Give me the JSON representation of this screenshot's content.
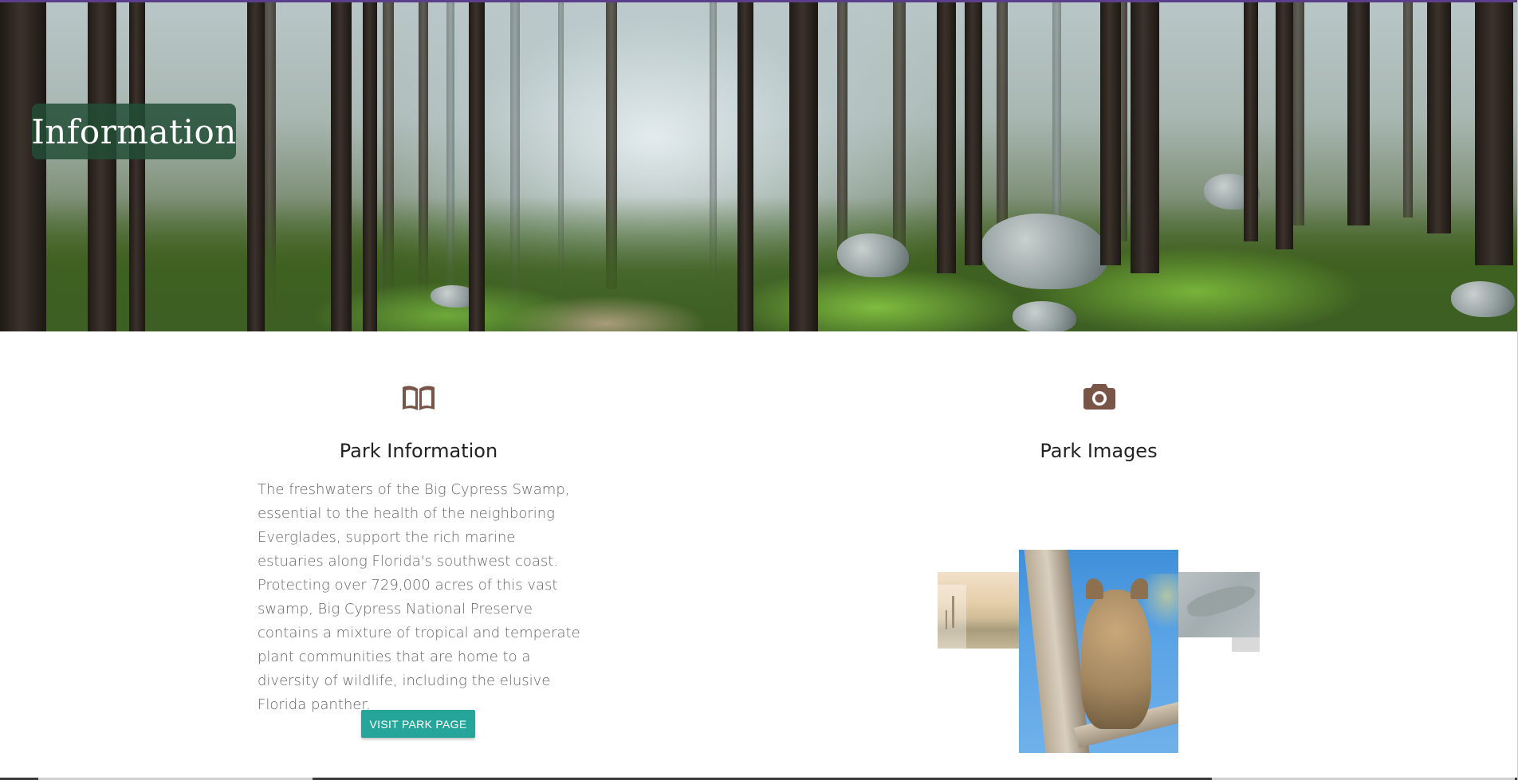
{
  "hero": {
    "title": "Information"
  },
  "columns": {
    "info": {
      "icon": "book-icon",
      "title": "Park Information",
      "text": "The freshwaters of the Big Cypress Swamp, essential to the health of the neighboring Everglades, support the rich marine estuaries along Florida's southwest coast. Protecting over 729,000 acres of this vast swamp, Big Cypress National Preserve contains a mixture of tropical and temperate plant communities that are home to a diversity of wildlife, including the elusive Florida panther.",
      "button_label": "VISIT PARK PAGE"
    },
    "images": {
      "icon": "camera-icon",
      "title": "Park Images",
      "items": [
        "swamp-image",
        "panther-image",
        "alligator-image"
      ]
    }
  },
  "colors": {
    "icon": "#795548",
    "button": "#26a69a",
    "hero_title_bg": "#224d35"
  }
}
